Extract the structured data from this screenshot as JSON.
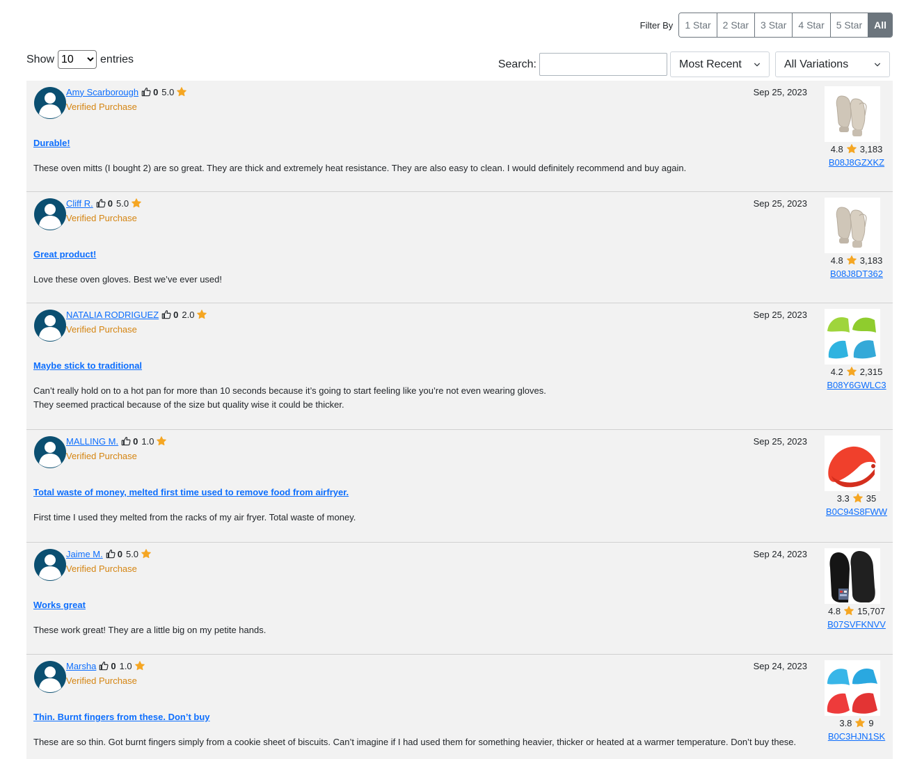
{
  "filter": {
    "label": "Filter By",
    "buttons": [
      "1 Star",
      "2 Star",
      "3 Star",
      "4 Star",
      "5 Star",
      "All"
    ],
    "active": "All"
  },
  "show": {
    "prefix": "Show",
    "value": "10",
    "suffix": "entries"
  },
  "search": {
    "label": "Search:",
    "value": ""
  },
  "sort": {
    "selected": "Most Recent"
  },
  "variations": {
    "selected": "All Variations"
  },
  "colors": {
    "link": "#0d6efd",
    "verified": "#d58512",
    "star": "#f5a623",
    "row_bg": "#f2f2f2"
  },
  "reviews": [
    {
      "author": "Amy Scarborough",
      "likes": "0",
      "rating": "5.0",
      "verified": "Verified Purchase",
      "date": "Sep 25, 2023",
      "title": "Durable!",
      "body": [
        "These oven mitts (I bought 2) are so great. They are thick and extremely heat resistance. They are also easy to clean. I would definitely recommend and buy again."
      ],
      "product": {
        "rating": "4.8",
        "count": "3,183",
        "asin": "B08J8GZXKZ",
        "image": "beige-oven-mitts"
      }
    },
    {
      "author": "Cliff R.",
      "likes": "0",
      "rating": "5.0",
      "verified": "Verified Purchase",
      "date": "Sep 25, 2023",
      "title": "Great product!",
      "body": [
        "Love these oven gloves. Best we’ve ever used!"
      ],
      "product": {
        "rating": "4.8",
        "count": "3,183",
        "asin": "B08J8DT362",
        "image": "beige-oven-mitts"
      }
    },
    {
      "author": "NATALIA RODRIGUEZ",
      "likes": "0",
      "rating": "2.0",
      "verified": "Verified Purchase",
      "date": "Sep 25, 2023",
      "title": "Maybe stick to traditional",
      "body": [
        "Can’t really hold on to a hot pan for more than 10 seconds because it’s going to start feeling like you’re not even wearing gloves.",
        "They seemed practical because of the size but quality wise it could be thicker."
      ],
      "product": {
        "rating": "4.2",
        "count": "2,315",
        "asin": "B08Y6GWLC3",
        "image": "green-blue-pinch-mitts"
      }
    },
    {
      "author": "MALLING M.",
      "likes": "0",
      "rating": "1.0",
      "verified": "Verified Purchase",
      "date": "Sep 25, 2023",
      "title": "Total waste of money, melted first time used to remove food from airfryer.",
      "body": [
        "First time I used they melted from the racks of my air fryer. Total waste of money."
      ],
      "product": {
        "rating": "3.3",
        "count": "35",
        "asin": "B0C94S8FWW",
        "image": "red-pinch-mitt"
      }
    },
    {
      "author": "Jaime M.",
      "likes": "0",
      "rating": "5.0",
      "verified": "Verified Purchase",
      "date": "Sep 24, 2023",
      "title": "Works great",
      "body": [
        "These work great! They are a little big on my petite hands."
      ],
      "product": {
        "rating": "4.8",
        "count": "15,707",
        "asin": "B07SVFKNVV",
        "image": "black-oven-mitts"
      }
    },
    {
      "author": "Marsha",
      "likes": "0",
      "rating": "1.0",
      "verified": "Verified Purchase",
      "date": "Sep 24, 2023",
      "title": "Thin. Burnt fingers from these. Don’t buy",
      "body": [
        "These are so thin. Got burnt fingers simply from a cookie sheet of biscuits. Can’t imagine if I had used them for something heavier, thicker or heated at a warmer temperature. Don’t buy these."
      ],
      "product": {
        "rating": "3.8",
        "count": "9",
        "asin": "B0C3HJN1SK",
        "image": "blue-red-pinch-mitts"
      }
    }
  ]
}
